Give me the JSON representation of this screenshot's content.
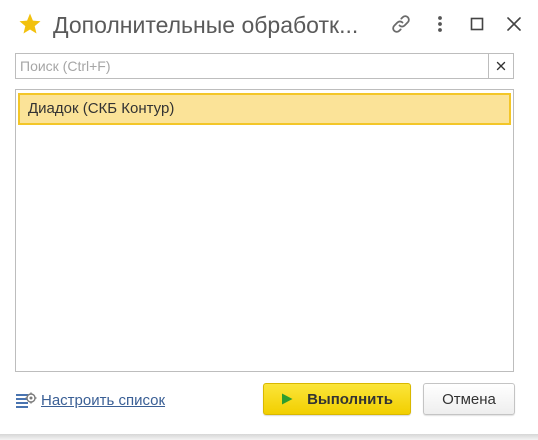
{
  "window": {
    "title": "Дополнительные обработк..."
  },
  "search": {
    "placeholder": "Поиск (Ctrl+F)",
    "value": ""
  },
  "list": {
    "items": [
      {
        "label": "Диадок (СКБ Контур)",
        "selected": true
      }
    ]
  },
  "footer": {
    "configure_label": "Настроить список",
    "run_label": "Выполнить",
    "cancel_label": "Отмена"
  },
  "icons": {
    "title": "star-icon",
    "link": "link-icon",
    "more": "more-vertical-icon",
    "maximize": "maximize-icon",
    "close": "close-icon",
    "search_clear": "clear-icon",
    "configure": "list-settings-icon",
    "run": "play-icon"
  },
  "colors": {
    "star": "#f2c10e",
    "selection_fill": "#fbe398",
    "selection_border": "#f3c628",
    "run_button": "#f6d80c",
    "link_text": "#3a5f95",
    "run_arrow": "#2e9d2e"
  }
}
